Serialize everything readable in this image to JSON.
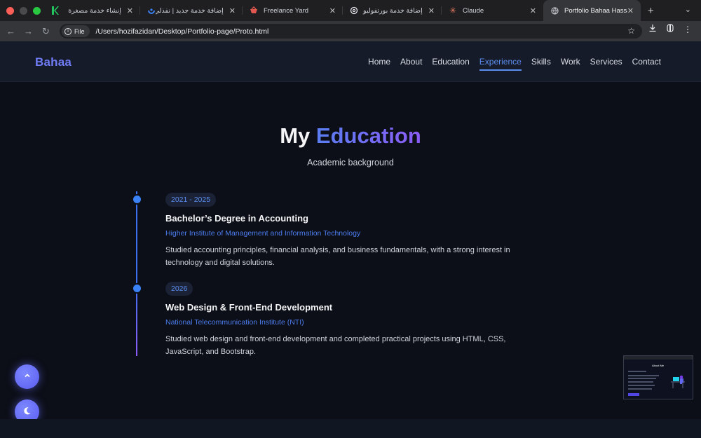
{
  "browser": {
    "tabs": [
      {
        "title": "إنشاء خدمة مصغرة",
        "icon": "k-logo-icon",
        "rtl": true
      },
      {
        "title": "إضافة خدمة جديد | نفذلي",
        "icon": "nafethly-icon",
        "rtl": true
      },
      {
        "title": "Freelance Yard",
        "icon": "freelance-yard-icon",
        "rtl": false
      },
      {
        "title": "إضافة خدمة بورتفوليو",
        "icon": "openai-icon",
        "rtl": true
      },
      {
        "title": "Claude",
        "icon": "claude-icon",
        "rtl": false
      },
      {
        "title": "Portfolio Bahaa Hassan",
        "icon": "globe-icon",
        "rtl": false
      }
    ],
    "url_chip": "File",
    "url": "/Users/hozifazidan/Desktop/Portfolio-page/Proto.html"
  },
  "site": {
    "logo": "Bahaa",
    "nav": [
      "Home",
      "About",
      "Education",
      "Experience",
      "Skills",
      "Work",
      "Services",
      "Contact"
    ],
    "active_nav": "Experience"
  },
  "section": {
    "title_plain": "My",
    "title_highlight": "Education",
    "subtitle": "Academic background"
  },
  "education": [
    {
      "year": "2021 - 2025",
      "degree": "Bachelor’s Degree in Accounting",
      "institution": "Higher Institute of Management and Information Technology",
      "description": "Studied accounting principles, financial analysis, and business fundamentals, with a strong interest in technology and digital solutions."
    },
    {
      "year": "2026",
      "degree": "Web Design & Front-End Development",
      "institution": "National Telecommunication Institute (NTI)",
      "description": "Studied web design and front-end development and completed practical projects using HTML, CSS, JavaScript, and Bootstrap."
    }
  ],
  "preview": {
    "title": "About Me"
  },
  "colors": {
    "accent": "#5b8def",
    "gradient_start": "#5a7ef2",
    "gradient_end": "#8b5cf6",
    "background": "#0c0f17"
  }
}
